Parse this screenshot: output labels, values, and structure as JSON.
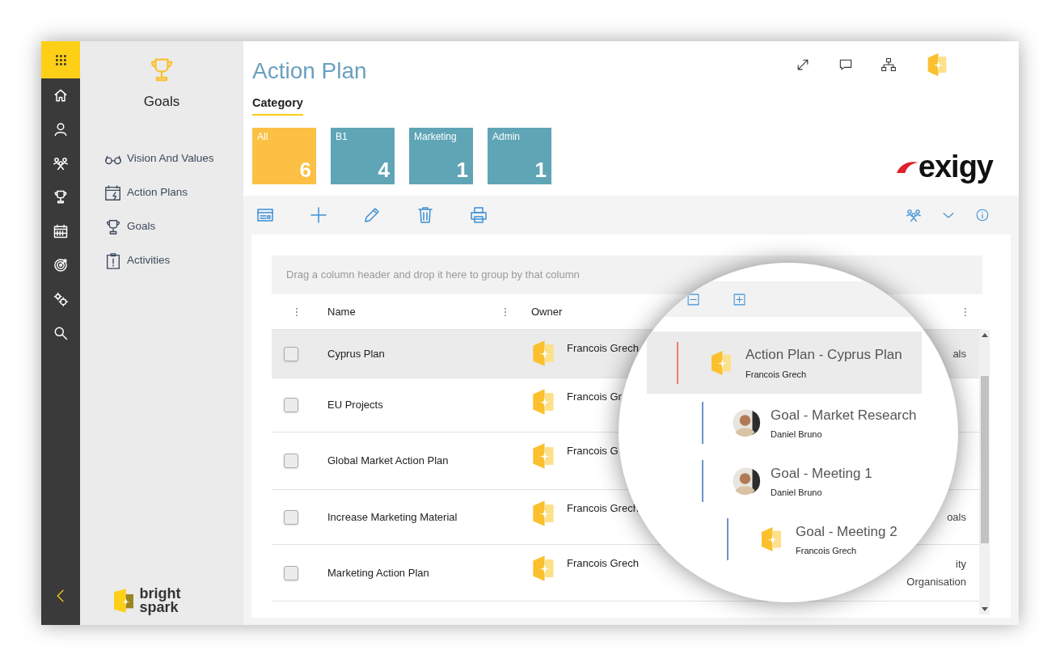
{
  "sidebar": {
    "title": "Goals",
    "items": [
      {
        "label": "Vision And Values",
        "kind": "glasses"
      },
      {
        "label": "Action Plans",
        "kind": "calendar"
      },
      {
        "label": "Goals",
        "kind": "trophy"
      },
      {
        "label": "Activities",
        "kind": "clipboard"
      }
    ]
  },
  "brand": {
    "lines": [
      "bright",
      "spark"
    ]
  },
  "page": {
    "title": "Action Plan",
    "filter_label": "Category",
    "logo": "exigy",
    "categories": [
      {
        "label": "All",
        "count": "6",
        "selected": true
      },
      {
        "label": "B1",
        "count": "4",
        "selected": false
      },
      {
        "label": "Marketing",
        "count": "1",
        "selected": false
      },
      {
        "label": "Admin",
        "count": "1",
        "selected": false
      }
    ]
  },
  "grid": {
    "group_hint": "Drag a column header and drop it here to group by that column",
    "columns": [
      "Name",
      "Owner"
    ],
    "rows": [
      {
        "name": "Cyprus Plan",
        "owner": "Francois Grech",
        "column_3": [
          "als"
        ],
        "selected": true,
        "checked": false
      },
      {
        "name": "EU Projects",
        "owner": "Francois Gr",
        "selected": false,
        "checked": false
      },
      {
        "name": "Global Market Action Plan",
        "owner": "Francois G",
        "selected": false,
        "checked": false
      },
      {
        "name": "Increase Marketing Material",
        "owner": "Francois Grech",
        "column_3": [
          "oals"
        ],
        "selected": false,
        "checked": false
      },
      {
        "name": "Marketing Action Plan",
        "owner": "Francois Grech",
        "column_3": [
          "ity",
          "Organisation"
        ],
        "selected": false,
        "checked": false
      }
    ]
  },
  "magnifier": {
    "items": [
      {
        "title": "Action Plan - Cyprus Plan",
        "owner": "Francois Grech",
        "kind": "logo",
        "color": "#e8806f",
        "selected": true,
        "children": [
          {
            "title": "Goal - Market Research",
            "owner": "Daniel Bruno",
            "kind": "person",
            "color": "#6f94c8",
            "selected": false
          },
          {
            "title": "Goal - Meeting 1",
            "owner": "Daniel Bruno",
            "kind": "person",
            "color": "#6f94c8",
            "selected": false,
            "children": [
              {
                "title": "Goal - Meeting 2",
                "owner": "Francois Grech",
                "kind": "logo",
                "color": "#6f94c8",
                "selected": false
              }
            ]
          }
        ]
      }
    ]
  }
}
